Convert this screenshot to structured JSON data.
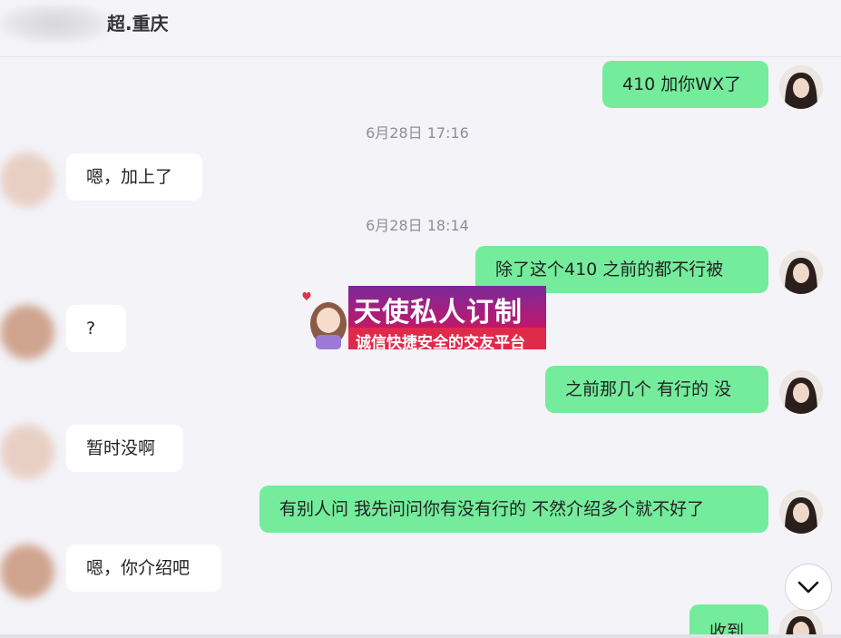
{
  "header": {
    "title": "超.重庆"
  },
  "messages": [
    {
      "text": "410 加你WX了"
    },
    {
      "text": "嗯，加上了"
    },
    {
      "text": "除了这个410  之前的都不行被"
    },
    {
      "text": "?"
    },
    {
      "text": "之前那几个 有行的 没"
    },
    {
      "text": "暂时没啊"
    },
    {
      "text": "有别人问 我先问问你有没有行的 不然介绍多个就不好了"
    },
    {
      "text": "嗯，你介绍吧"
    },
    {
      "text": "收到"
    }
  ],
  "timestamps": [
    "6月28日 17:16",
    "6月28日 18:14"
  ],
  "watermark": {
    "title": "天使私人订制",
    "subtitle": "诚信快捷安全的交友平台"
  },
  "colors": {
    "outgoing_bubble": "#74ec9c",
    "incoming_bubble": "#ffffff",
    "background": "#f3f3f8"
  },
  "icons": {
    "scroll": "chevron-down-icon"
  }
}
